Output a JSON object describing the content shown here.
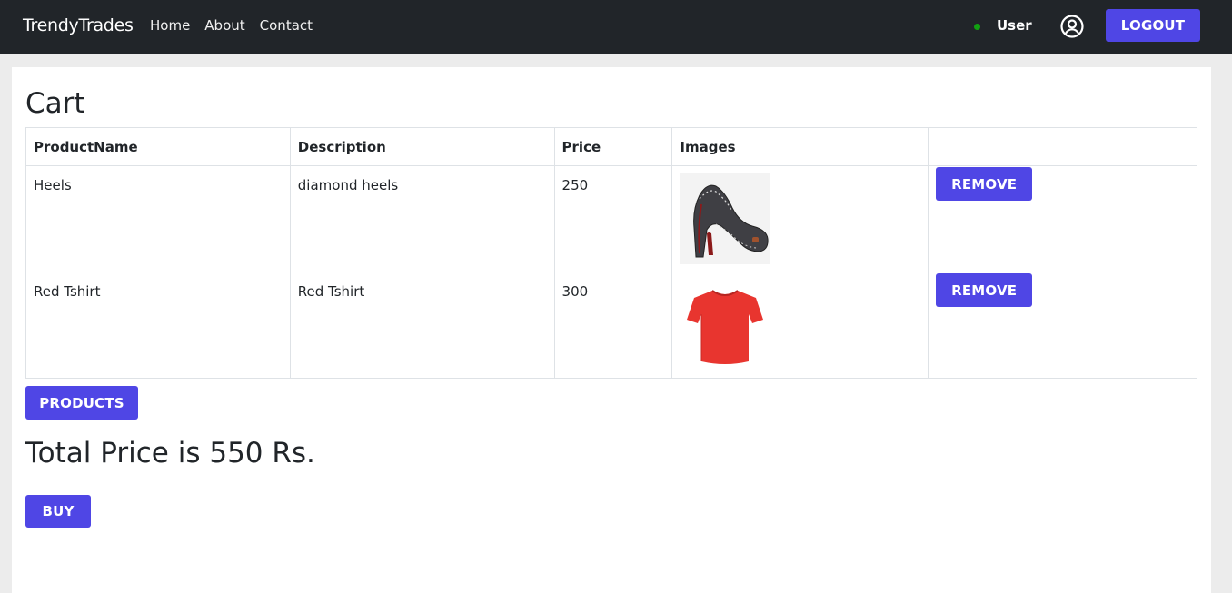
{
  "navbar": {
    "brand": "TrendyTrades",
    "links": [
      {
        "label": "Home"
      },
      {
        "label": "About"
      },
      {
        "label": "Contact"
      }
    ],
    "user_label": "User",
    "logout_label": "LOGOUT",
    "status_color": "#11a011",
    "user_icon": "user-circle-icon"
  },
  "cart": {
    "title": "Cart",
    "columns": [
      "ProductName",
      "Description",
      "Price",
      "Images",
      ""
    ],
    "rows": [
      {
        "name": "Heels",
        "description": "diamond heels",
        "price": "250",
        "image": "heels-image",
        "action": "REMOVE"
      },
      {
        "name": "Red Tshirt",
        "description": "Red Tshirt",
        "price": "300",
        "image": "red-tshirt-image",
        "action": "REMOVE"
      }
    ]
  },
  "products_label": "PRODUCTS",
  "total_text": "Total Price is 550 Rs.",
  "buy_label": "BUY",
  "colors": {
    "navbar_bg": "#212529",
    "accent": "#4f46e5",
    "page_bg": "#ececec"
  }
}
